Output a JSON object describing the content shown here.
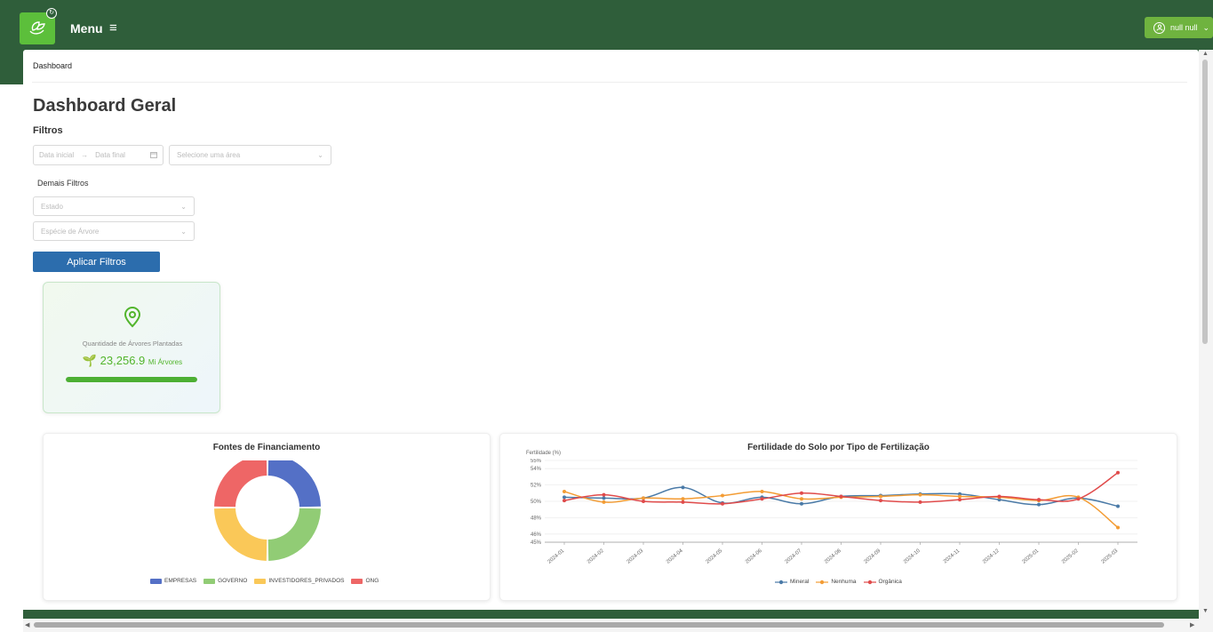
{
  "header": {
    "menu_label": "Menu",
    "menu_icon": "hamburger-icon",
    "logo_icon": "leaf-hands-icon",
    "user_name": "null null",
    "user_icon": "user-icon",
    "user_chevron": "chevron-down-icon"
  },
  "breadcrumb": "Dashboard",
  "page_title": "Dashboard Geral",
  "filters": {
    "title": "Filtros",
    "date_start_placeholder": "Data inicial",
    "date_end_placeholder": "Data final",
    "date_arrow": "→",
    "area_placeholder": "Selecione uma área",
    "more_filters_title": "Demais Filtros",
    "state_placeholder": "Estado",
    "species_placeholder": "Espécie de Árvore",
    "apply_label": "Aplicar Filtros"
  },
  "stat_card": {
    "icon": "map-pin-icon",
    "label": "Quantidade de Árvores Plantadas",
    "value": "23,256.9",
    "unit": "Mi Árvores",
    "progress": 1.0,
    "accent": "#52b52c"
  },
  "funding_chart": {
    "title": "Fontes de Financiamento",
    "legend": [
      "EMPRESAS",
      "GOVERNO",
      "INVESTIDORES_PRIVADOS",
      "ONG"
    ],
    "colors": [
      "#5470c6",
      "#91cc75",
      "#fac858",
      "#ee6666"
    ]
  },
  "soil_chart": {
    "title": "Fertilidade do Solo por Tipo de Fertilização",
    "ylabel": "Fertilidade (%)",
    "legend": [
      "Mineral",
      "Nenhuma",
      "Orgânica"
    ],
    "colors": [
      "#4a7aa7",
      "#f39c34",
      "#e04b4b"
    ]
  },
  "chart_data": [
    {
      "type": "pie",
      "title": "Fontes de Financiamento",
      "categories": [
        "EMPRESAS",
        "GOVERNO",
        "INVESTIDORES_PRIVADOS",
        "ONG"
      ],
      "values": [
        25,
        25,
        25,
        25
      ]
    },
    {
      "type": "line",
      "title": "Fertilidade do Solo por Tipo de Fertilização",
      "ylabel": "Fertilidade (%)",
      "y_ticks": [
        "45%",
        "46%",
        "48%",
        "50%",
        "52%",
        "54%",
        "55%"
      ],
      "ylim": [
        45,
        55
      ],
      "categories": [
        "2024-01",
        "2024-02",
        "2024-03",
        "2024-04",
        "2024-05",
        "2024-06",
        "2024-07",
        "2024-08",
        "2024-09",
        "2024-10",
        "2024-11",
        "2024-12",
        "2025-01",
        "2025-02",
        "2025-03"
      ],
      "series": [
        {
          "name": "Mineral",
          "values": [
            50.5,
            50.4,
            50.4,
            51.7,
            49.8,
            50.5,
            49.7,
            50.6,
            50.7,
            50.9,
            50.9,
            50.2,
            49.6,
            50.4,
            49.4
          ]
        },
        {
          "name": "Nenhuma",
          "values": [
            51.2,
            49.9,
            50.4,
            50.3,
            50.7,
            51.2,
            50.3,
            50.5,
            50.6,
            50.8,
            50.6,
            50.5,
            50.1,
            50.5,
            46.8
          ]
        },
        {
          "name": "Orgânica",
          "values": [
            50.1,
            50.8,
            50.0,
            49.9,
            49.7,
            50.3,
            51.0,
            50.6,
            50.1,
            49.9,
            50.2,
            50.6,
            50.2,
            50.3,
            53.5
          ]
        }
      ],
      "legend_position": "bottom"
    }
  ]
}
